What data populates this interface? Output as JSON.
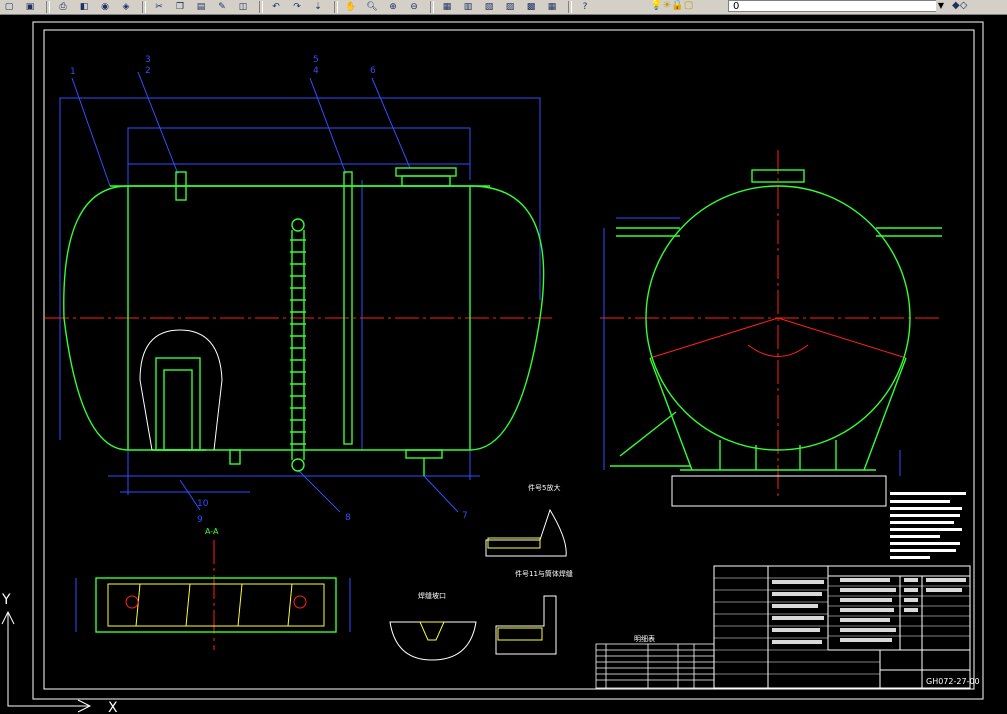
{
  "toolbar": {
    "buttons": [
      "new-icon",
      "save-icon",
      "print-icon",
      "preview-icon",
      "publish-icon",
      "cut-icon",
      "copy-icon",
      "paste-icon",
      "match-properties-icon",
      "undo-icon",
      "redo-icon",
      "pan-icon",
      "zoom-realtime-icon",
      "zoom-window-icon",
      "zoom-previous-icon",
      "properties-icon",
      "design-center-icon",
      "tool-palette-icon",
      "calc-icon",
      "table-icon",
      "help-icon"
    ],
    "layer_value": "0"
  },
  "drawing": {
    "callouts": [
      "1",
      "3",
      "2",
      "5",
      "4",
      "6",
      "10",
      "9",
      "8",
      "7"
    ],
    "section_title_1": "A-A",
    "detail_title_1": "件号5放大",
    "detail_title_2": "件号11与筒体焊缝",
    "detail_title_3": "焊缝坡口",
    "parts_list_title": "明细表",
    "drawing_number": "GH072-27-00",
    "ucs_x": "X",
    "ucs_y": "Y"
  },
  "colors": {
    "vessel": "#33ff33",
    "dimension": "#3050ff",
    "centerline": "#ff2020",
    "frame": "#ffffff",
    "hatch": "#ffff33"
  }
}
